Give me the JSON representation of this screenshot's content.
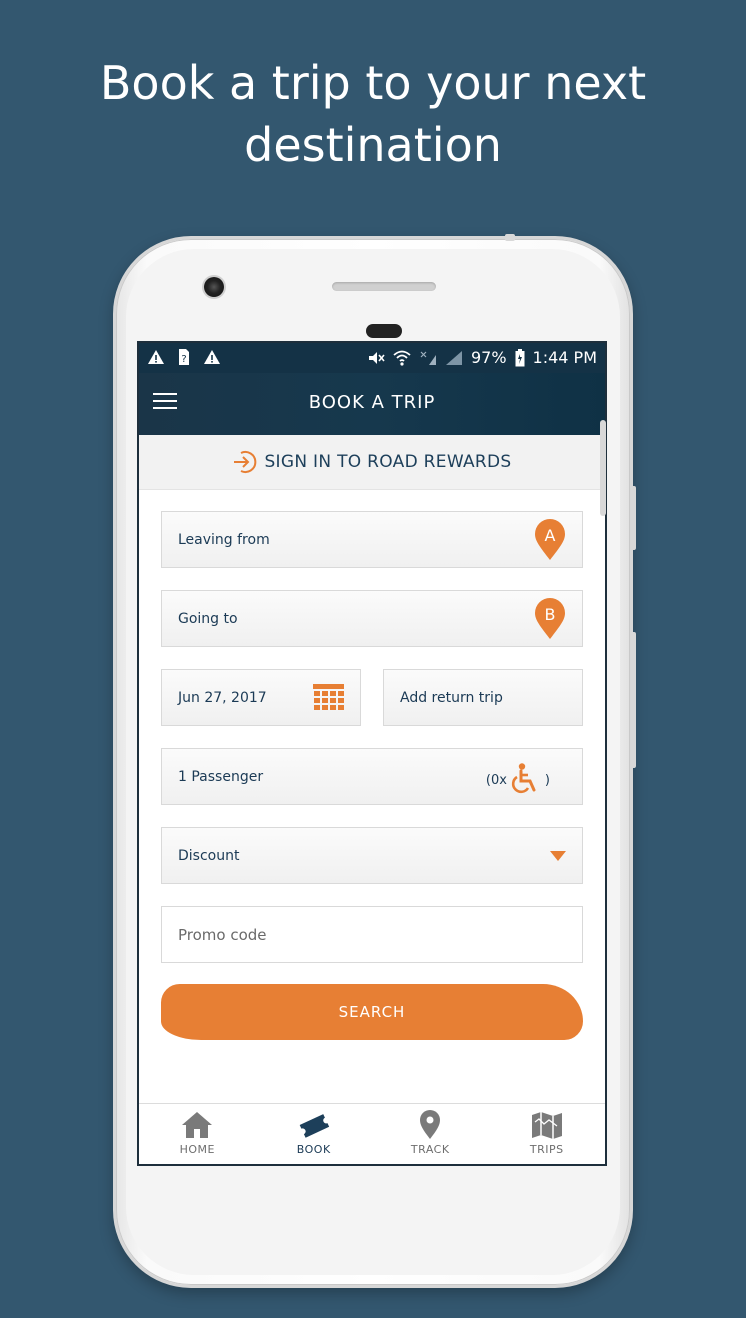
{
  "headline": {
    "line1": "Book a trip to your next",
    "line2": "destination"
  },
  "statusbar": {
    "battery": "97%",
    "time": "1:44 PM"
  },
  "appbar": {
    "title": "BOOK A TRIP"
  },
  "signin": {
    "label": "SIGN IN TO ROAD REWARDS"
  },
  "form": {
    "leaving_from": "Leaving from",
    "leaving_marker": "A",
    "going_to": "Going to",
    "going_marker": "B",
    "date": "Jun 27, 2017",
    "return_trip": "Add return trip",
    "passengers": "1 Passenger",
    "wheelchair_count_prefix": "(0x",
    "wheelchair_count_suffix": ")",
    "discount": "Discount",
    "promo_placeholder": "Promo code",
    "search": "SEARCH"
  },
  "nav": {
    "items": [
      {
        "label": "HOME"
      },
      {
        "label": "BOOK"
      },
      {
        "label": "TRACK"
      },
      {
        "label": "TRIPS"
      }
    ],
    "active": "BOOK"
  },
  "colors": {
    "background": "#33576f",
    "accent": "#e77f34",
    "primary": "#143246",
    "text": "#1b3a55"
  }
}
